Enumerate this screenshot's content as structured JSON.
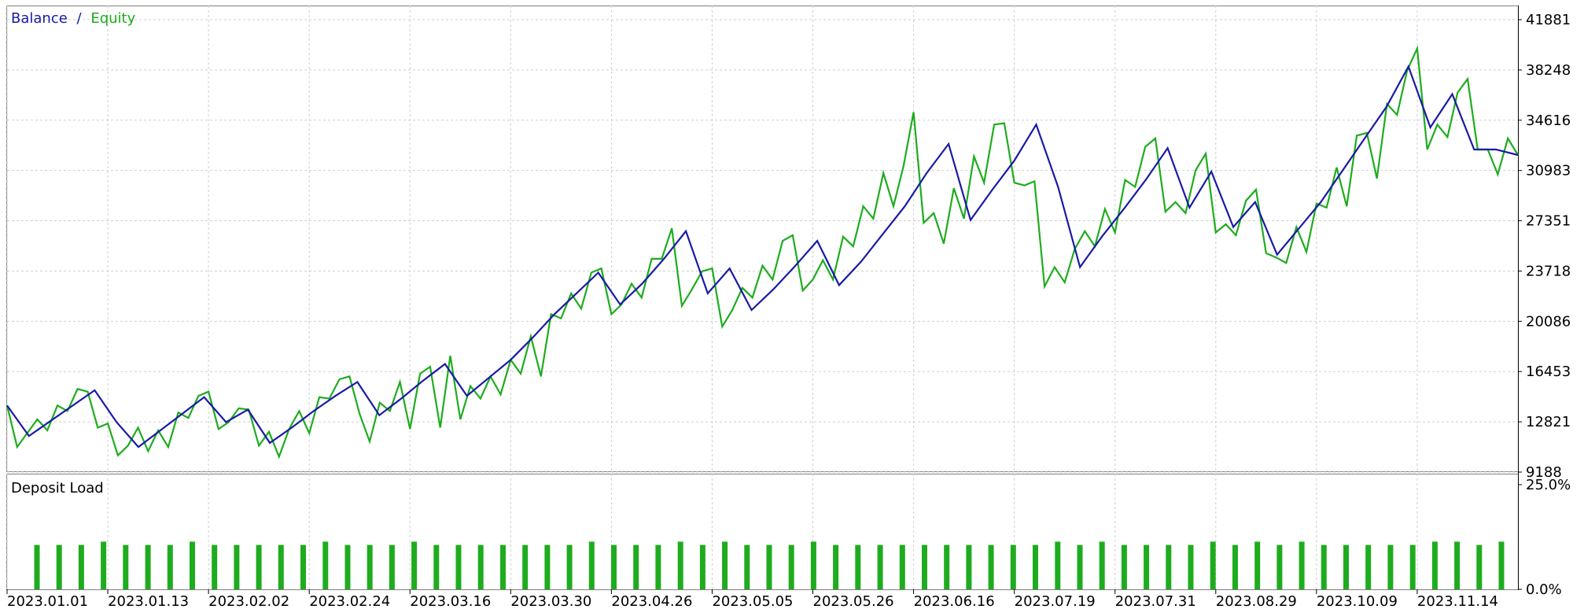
{
  "chart_data": [
    {
      "type": "line",
      "legend": {
        "balance_label": "Balance",
        "separator": "/",
        "equity_label": "Equity"
      },
      "ylim": [
        9188,
        41881
      ],
      "y_ticks": [
        9188,
        12821,
        16453,
        20086,
        23718,
        27351,
        30983,
        34616,
        38248,
        41881
      ],
      "x_ticks": [
        "2023.01.01",
        "2023.01.13",
        "2023.02.02",
        "2023.02.24",
        "2023.03.16",
        "2023.03.30",
        "2023.04.26",
        "2023.05.05",
        "2023.05.26",
        "2023.06.16",
        "2023.07.19",
        "2023.07.31",
        "2023.08.29",
        "2023.10.09",
        "2023.11.14"
      ],
      "grid": true,
      "series": [
        {
          "name": "Balance",
          "color": "#1a1aa6",
          "values": [
            14000,
            11800,
            12900,
            14000,
            15100,
            12800,
            11000,
            12200,
            13400,
            14600,
            12800,
            13700,
            11300,
            12400,
            13600,
            14700,
            15700,
            13300,
            14500,
            15800,
            17000,
            14700,
            16000,
            17300,
            18900,
            20600,
            22100,
            23600,
            21300,
            22800,
            24600,
            26600,
            22100,
            23900,
            20900,
            22400,
            24100,
            25900,
            22700,
            24400,
            26400,
            28400,
            30800,
            32900,
            27400,
            29600,
            31700,
            34300,
            29800,
            24000,
            26200,
            28200,
            30300,
            32600,
            28300,
            30900,
            26900,
            28700,
            24900,
            26800,
            28700,
            31000,
            33300,
            35600,
            38500,
            34100,
            36500,
            32500,
            32500,
            32100
          ]
        },
        {
          "name": "Equity",
          "color": "#1eac1e",
          "values": [
            14000,
            11000,
            12000,
            13000,
            12200,
            14000,
            13600,
            15200,
            15000,
            12400,
            12700,
            10400,
            11100,
            12400,
            10700,
            12200,
            11000,
            13500,
            13100,
            14700,
            15000,
            12300,
            12800,
            13800,
            13700,
            11100,
            12100,
            10300,
            12300,
            13600,
            12000,
            14600,
            14500,
            15900,
            16100,
            13400,
            11400,
            14200,
            13600,
            15700,
            12300,
            16300,
            16800,
            12400,
            17600,
            13000,
            15400,
            14500,
            16100,
            14800,
            17300,
            16300,
            19000,
            16100,
            20600,
            20300,
            22100,
            21000,
            23600,
            23900,
            20600,
            21300,
            22800,
            21800,
            24600,
            24600,
            26800,
            21200,
            22400,
            23700,
            23900,
            19700,
            20900,
            22500,
            21800,
            24100,
            23100,
            25900,
            26300,
            22300,
            23100,
            24500,
            23100,
            26200,
            25500,
            28400,
            27500,
            30800,
            28400,
            31300,
            35200,
            27200,
            27900,
            25700,
            29700,
            27500,
            32000,
            30100,
            34300,
            34400,
            30100,
            29900,
            30200,
            22600,
            24000,
            22900,
            25300,
            26600,
            25500,
            28200,
            26500,
            30300,
            29800,
            32700,
            33300,
            28000,
            28700,
            27900,
            31000,
            32200,
            26500,
            27100,
            26300,
            28800,
            29600,
            25000,
            24700,
            24300,
            26900,
            25100,
            28600,
            28300,
            31200,
            28400,
            33500,
            33700,
            30400,
            35800,
            35000,
            38200,
            39800,
            32500,
            34300,
            33400,
            36600,
            37600,
            32500,
            32500,
            30700,
            33300,
            32100
          ]
        }
      ]
    },
    {
      "type": "bar",
      "title": "Deposit Load",
      "ylim": [
        0,
        25
      ],
      "y_ticks": [
        "25.0%",
        "0.0%"
      ],
      "color": "#1eac1e",
      "values": [
        10.6,
        10.6,
        10.6,
        11.4,
        10.6,
        10.6,
        10.6,
        11.4,
        10.6,
        10.6,
        10.6,
        10.6,
        10.6,
        11.4,
        10.6,
        10.6,
        10.6,
        11.4,
        10.6,
        10.6,
        10.6,
        10.6,
        10.6,
        10.6,
        10.6,
        11.4,
        10.6,
        10.6,
        10.6,
        11.4,
        10.6,
        11.4,
        10.6,
        10.6,
        10.6,
        11.4,
        10.6,
        10.6,
        10.6,
        10.6,
        10.6,
        10.6,
        10.6,
        10.6,
        10.6,
        10.6,
        11.4,
        10.6,
        11.4,
        10.6,
        10.6,
        10.6,
        10.6,
        11.4,
        10.6,
        11.4,
        10.6,
        11.4,
        10.6,
        10.6,
        10.6,
        10.6,
        10.6,
        11.4,
        11.4,
        10.6,
        11.4
      ]
    }
  ]
}
